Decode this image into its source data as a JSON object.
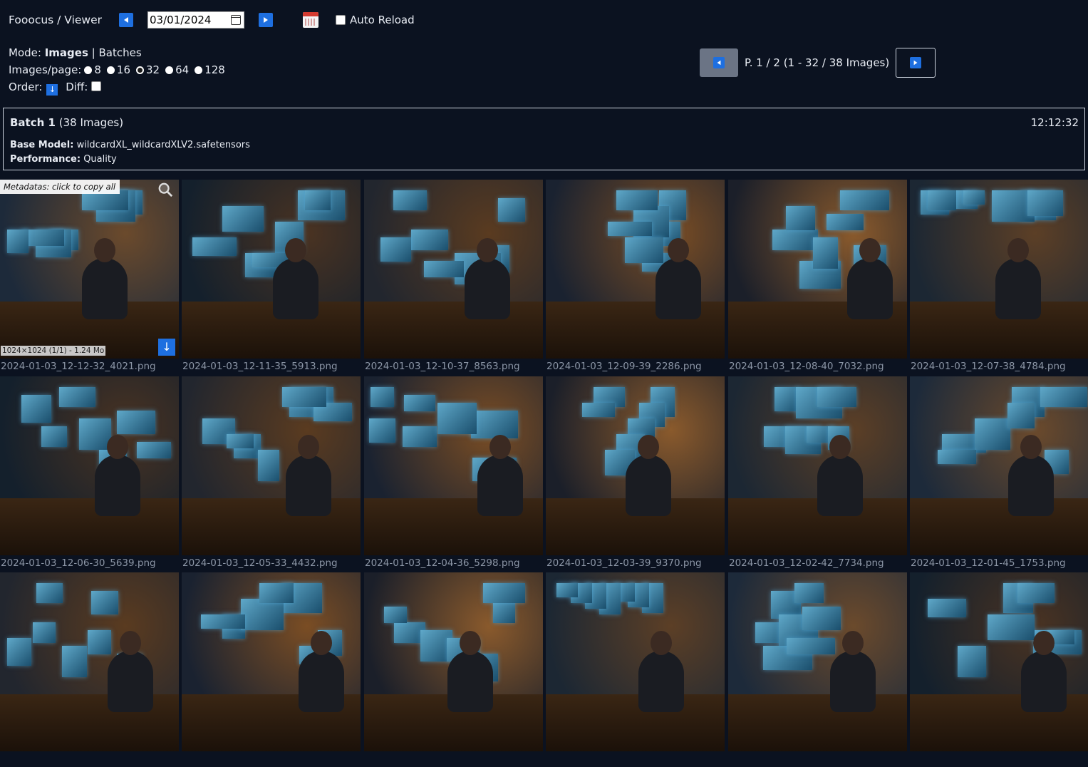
{
  "header": {
    "title": "Fooocus / Viewer",
    "date": "03/01/2024",
    "auto_reload_label": "Auto Reload"
  },
  "controls": {
    "mode_label": "Mode:",
    "mode_images": "Images",
    "mode_sep": "|",
    "mode_batches": "Batches",
    "per_page_label": "Images/page:",
    "per_page_options": [
      "8",
      "16",
      "32",
      "64",
      "128"
    ],
    "per_page_selected": "32",
    "order_label": "Order:",
    "order_icon": "↓",
    "diff_label": "Diff:"
  },
  "pager": {
    "info": "P. 1 / 2 (1 - 32 / 38 Images)"
  },
  "batch": {
    "title_bold": "Batch 1",
    "title_rest": "(38 Images)",
    "time": "12:12:32",
    "base_model_label": "Base Model:",
    "base_model_value": "wildcardXL_wildcardXLV2.safetensors",
    "performance_label": "Performance:",
    "performance_value": "Quality"
  },
  "first_thumb": {
    "meta_label": "Metadatas: click to copy all",
    "size_label": "1024×1024 (1/1) - 1.24 Mo",
    "download_icon": "↓"
  },
  "images": [
    {
      "name": "2024-01-03_12-12-32_4021.png"
    },
    {
      "name": "2024-01-03_12-11-35_5913.png"
    },
    {
      "name": "2024-01-03_12-10-37_8563.png"
    },
    {
      "name": "2024-01-03_12-09-39_2286.png"
    },
    {
      "name": "2024-01-03_12-08-40_7032.png"
    },
    {
      "name": "2024-01-03_12-07-38_4784.png"
    },
    {
      "name": "2024-01-03_12-06-30_5639.png"
    },
    {
      "name": "2024-01-03_12-05-33_4432.png"
    },
    {
      "name": "2024-01-03_12-04-36_5298.png"
    },
    {
      "name": "2024-01-03_12-03-39_9370.png"
    },
    {
      "name": "2024-01-03_12-02-42_7734.png"
    },
    {
      "name": "2024-01-03_12-01-45_1753.png"
    },
    {
      "name": ""
    },
    {
      "name": ""
    },
    {
      "name": ""
    },
    {
      "name": ""
    },
    {
      "name": ""
    },
    {
      "name": ""
    }
  ],
  "colors": {
    "background": "#0b1220",
    "accent": "#1e6fe0"
  }
}
